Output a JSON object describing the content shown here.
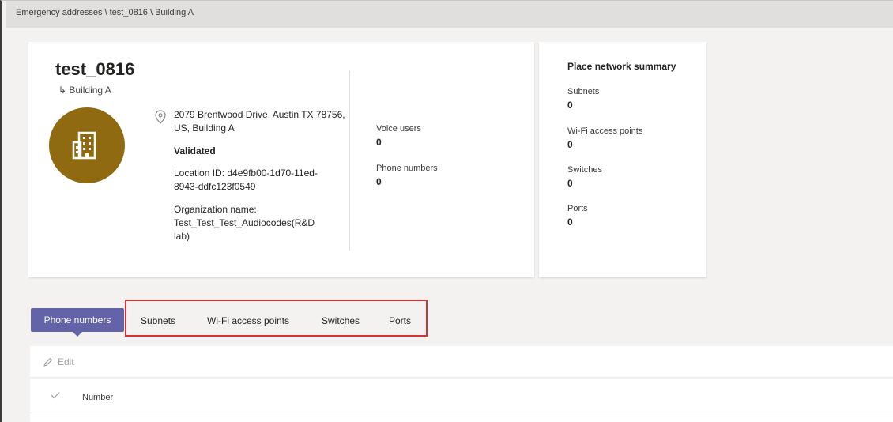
{
  "breadcrumb": "Emergency addresses \\ test_0816 \\ Building A",
  "place": {
    "title": "test_0816",
    "subplace": "↳ Building A",
    "avatar_color": "#8f6a10",
    "avatar_icon": "building-icon",
    "address": "2079 Brentwood Drive, Austin TX 78756, US, Building A",
    "status": "Validated",
    "location_id": "Location ID: d4e9fb00-1d70-11ed-8943-ddfc123f0549",
    "org_label": "Organization name:",
    "org_name": "Test_Test_Test_Audiocodes(R&D lab)"
  },
  "stats": {
    "voice_users_label": "Voice users",
    "voice_users_value": "0",
    "phone_numbers_label": "Phone numbers",
    "phone_numbers_value": "0"
  },
  "summary": {
    "title": "Place network summary",
    "items": [
      {
        "label": "Subnets",
        "value": "0"
      },
      {
        "label": "Wi-Fi access points",
        "value": "0"
      },
      {
        "label": "Switches",
        "value": "0"
      },
      {
        "label": "Ports",
        "value": "0"
      }
    ]
  },
  "tabs": {
    "active": "Phone numbers",
    "items": [
      "Subnets",
      "Wi-Fi access points",
      "Switches",
      "Ports"
    ]
  },
  "toolbar": {
    "edit_label": "Edit"
  },
  "table": {
    "columns": [
      "Number"
    ]
  },
  "colors": {
    "accent": "#6264a7",
    "highlight": "#d13438"
  }
}
